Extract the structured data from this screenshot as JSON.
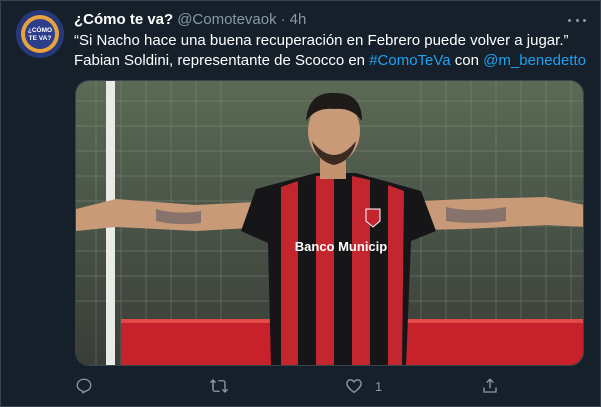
{
  "tweet": {
    "display_name": "¿Cómo te va?",
    "handle": "@Comotevaok",
    "separator": "·",
    "timestamp": "4h",
    "text_line1": "“Si Nacho hace una buena recuperación en Febrero puede volver a jugar.”",
    "text_line2_a": "Fabian Soldini, representante de Scocco en ",
    "hashtag": "#ComoTeVa",
    "text_line2_b": " con ",
    "mention": "@m_benedetto"
  },
  "avatar": {
    "line1": "¿CÓMO",
    "line2": "TE VA?"
  },
  "media": {
    "shirt_text": "Banco Municip"
  },
  "actions": {
    "reply_count": "",
    "retweet_count": "",
    "like_count": "1"
  },
  "icons": {
    "reply": "reply-icon",
    "retweet": "retweet-icon",
    "like": "heart-icon",
    "share": "share-icon",
    "more": "more-options-icon"
  },
  "colors": {
    "background": "#15202b",
    "link": "#1da1f2",
    "muted": "#8899a6",
    "border": "#38444d"
  }
}
